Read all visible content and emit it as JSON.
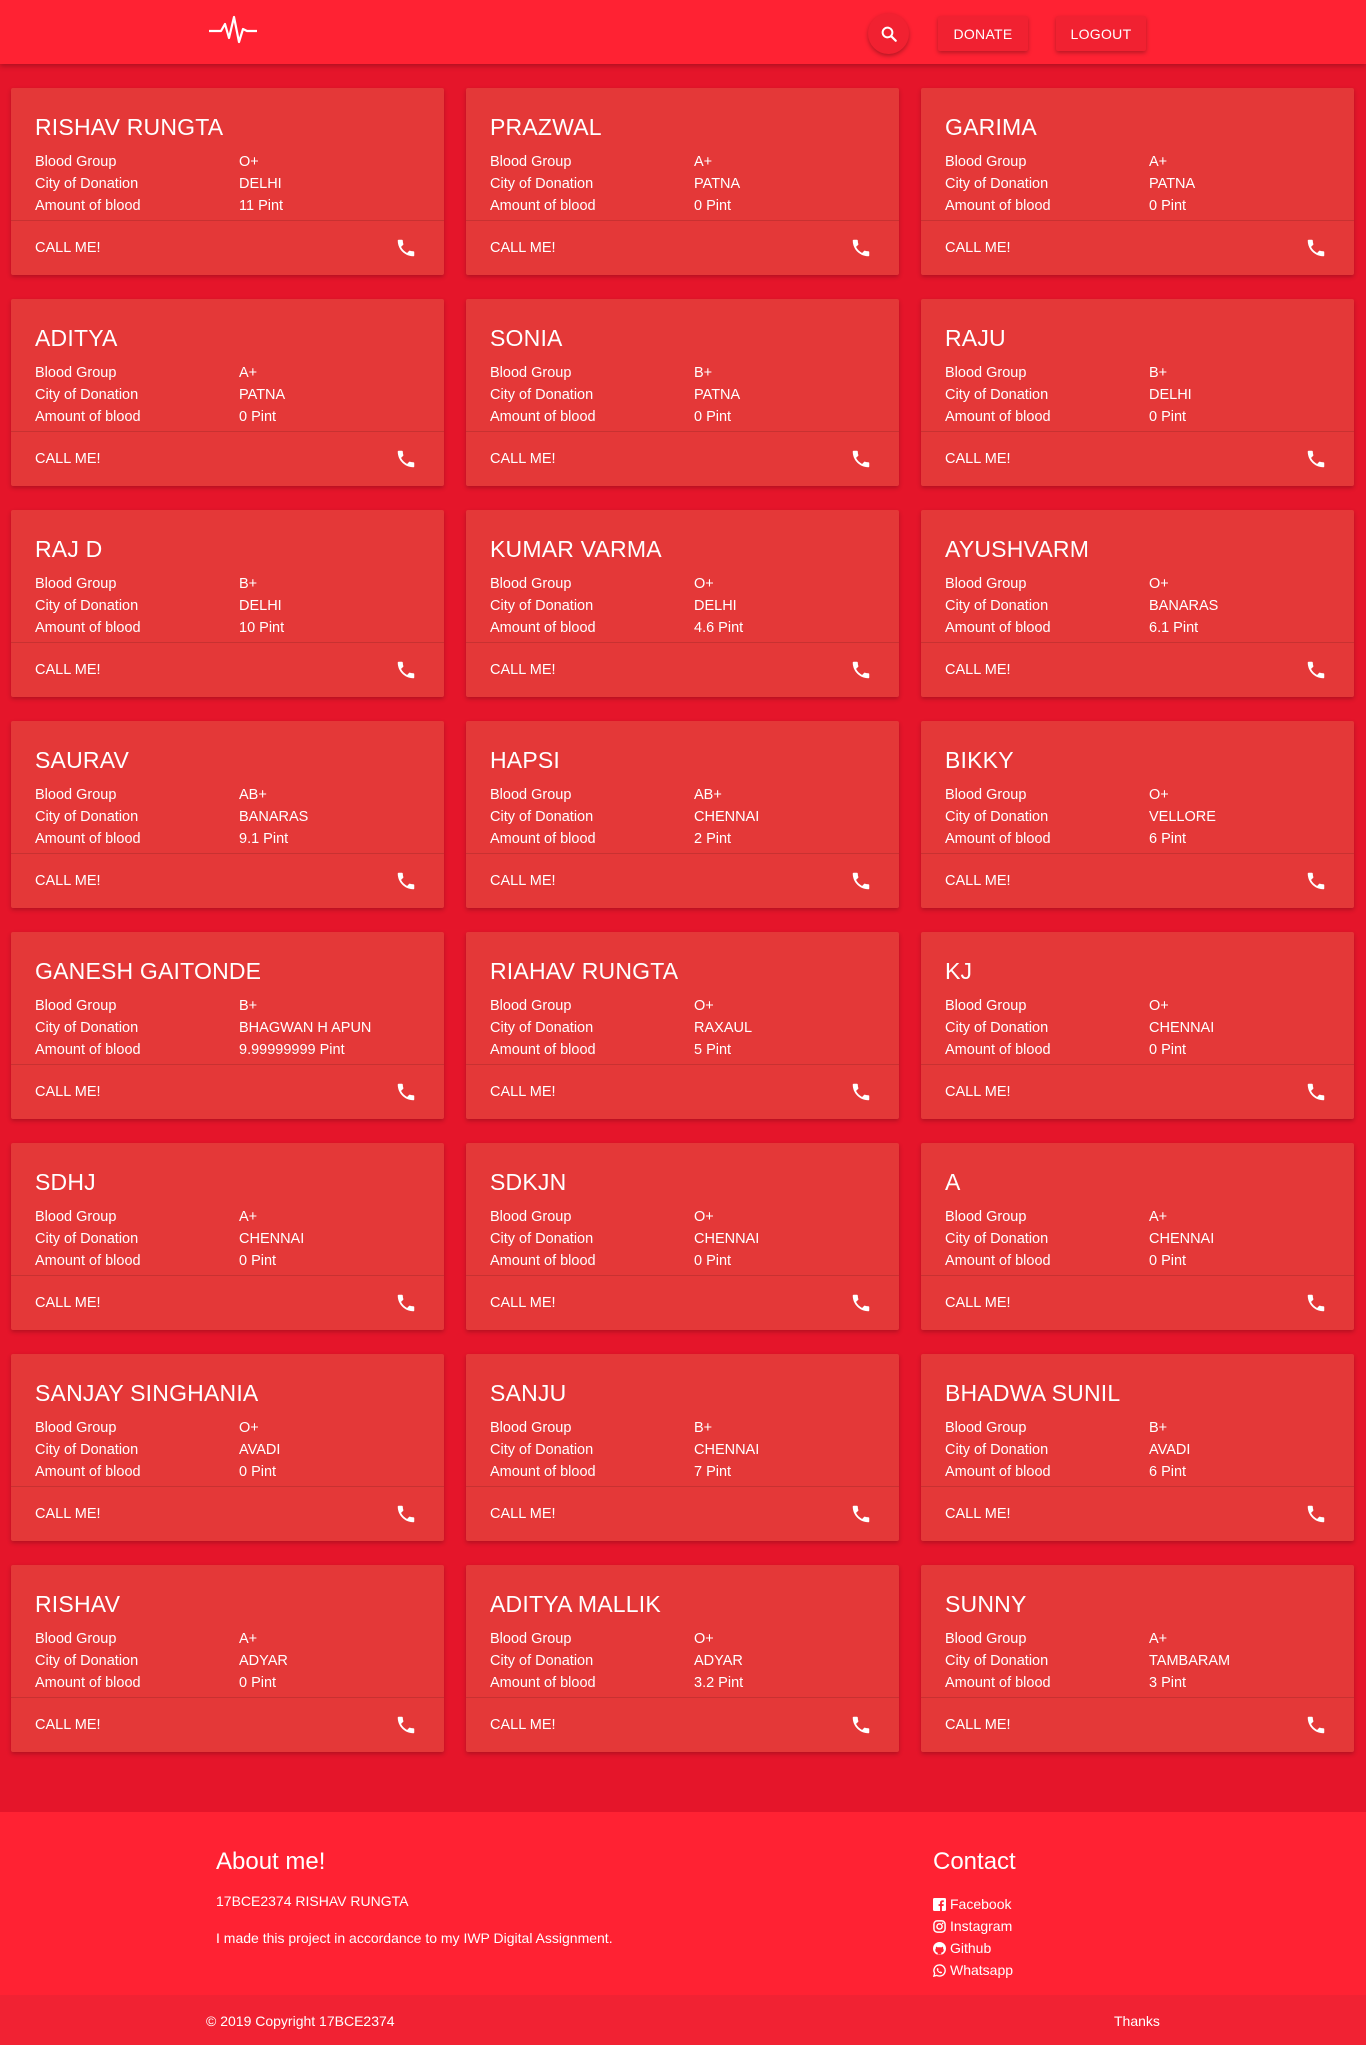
{
  "nav": {
    "donate_label": "DONATE",
    "logout_label": "LOGOUT"
  },
  "labels": {
    "blood_group": "Blood Group",
    "city": "City of Donation",
    "amount": "Amount of blood",
    "call": "CALL ME!"
  },
  "donors": [
    {
      "name": "RISHAV RUNGTA",
      "blood_group": "O+",
      "city": "DELHI",
      "amount": "11 Pint"
    },
    {
      "name": "PRAZWAL",
      "blood_group": "A+",
      "city": "PATNA",
      "amount": "0 Pint"
    },
    {
      "name": "GARIMA",
      "blood_group": "A+",
      "city": "PATNA",
      "amount": "0 Pint"
    },
    {
      "name": "ADITYA",
      "blood_group": "A+",
      "city": "PATNA",
      "amount": "0 Pint"
    },
    {
      "name": "SONIA",
      "blood_group": "B+",
      "city": "PATNA",
      "amount": "0 Pint"
    },
    {
      "name": "RAJU",
      "blood_group": "B+",
      "city": "DELHI",
      "amount": "0 Pint"
    },
    {
      "name": "RAJ D",
      "blood_group": "B+",
      "city": "DELHI",
      "amount": "10 Pint"
    },
    {
      "name": "KUMAR VARMA",
      "blood_group": "O+",
      "city": "DELHI",
      "amount": "4.6 Pint"
    },
    {
      "name": "AYUSHVARM",
      "blood_group": "O+",
      "city": "BANARAS",
      "amount": "6.1 Pint"
    },
    {
      "name": "SAURAV",
      "blood_group": "AB+",
      "city": "BANARAS",
      "amount": "9.1 Pint"
    },
    {
      "name": "HAPSI",
      "blood_group": "AB+",
      "city": "CHENNAI",
      "amount": "2 Pint"
    },
    {
      "name": "BIKKY",
      "blood_group": "O+",
      "city": "VELLORE",
      "amount": "6 Pint"
    },
    {
      "name": "GANESH GAITONDE",
      "blood_group": "B+",
      "city": "BHAGWAN H APUN",
      "amount": "9.99999999 Pint"
    },
    {
      "name": "RIAHAV RUNGTA",
      "blood_group": "O+",
      "city": "RAXAUL",
      "amount": "5 Pint"
    },
    {
      "name": "KJ",
      "blood_group": "O+",
      "city": "CHENNAI",
      "amount": "0 Pint"
    },
    {
      "name": "SDHJ",
      "blood_group": "A+",
      "city": "CHENNAI",
      "amount": "0 Pint"
    },
    {
      "name": "SDKJN",
      "blood_group": "O+",
      "city": "CHENNAI",
      "amount": "0 Pint"
    },
    {
      "name": "A",
      "blood_group": "A+",
      "city": "CHENNAI",
      "amount": "0 Pint"
    },
    {
      "name": "SANJAY SINGHANIA",
      "blood_group": "O+",
      "city": "AVADI",
      "amount": "0 Pint"
    },
    {
      "name": "SANJU",
      "blood_group": "B+",
      "city": "CHENNAI",
      "amount": "7 Pint"
    },
    {
      "name": "BHADWA SUNIL",
      "blood_group": "B+",
      "city": "AVADI",
      "amount": "6 Pint"
    },
    {
      "name": "RISHAV",
      "blood_group": "A+",
      "city": "ADYAR",
      "amount": "0 Pint"
    },
    {
      "name": "ADITYA MALLIK",
      "blood_group": "O+",
      "city": "ADYAR",
      "amount": "3.2 Pint"
    },
    {
      "name": "SUNNY",
      "blood_group": "A+",
      "city": "TAMBARAM",
      "amount": "3 Pint"
    }
  ],
  "footer": {
    "about_title": "About me!",
    "about_id": "17BCE2374 RISHAV RUNGTA",
    "about_desc": "I made this project in accordance to my IWP Digital Assignment.",
    "contact_title": "Contact",
    "contacts": [
      {
        "label": "Facebook",
        "icon": "facebook-icon"
      },
      {
        "label": "Instagram",
        "icon": "instagram-icon"
      },
      {
        "label": "Github",
        "icon": "github-icon"
      },
      {
        "label": "Whatsapp",
        "icon": "whatsapp-icon"
      }
    ],
    "copyright": "© 2019 Copyright 17BCE2374",
    "thanks": "Thanks"
  }
}
